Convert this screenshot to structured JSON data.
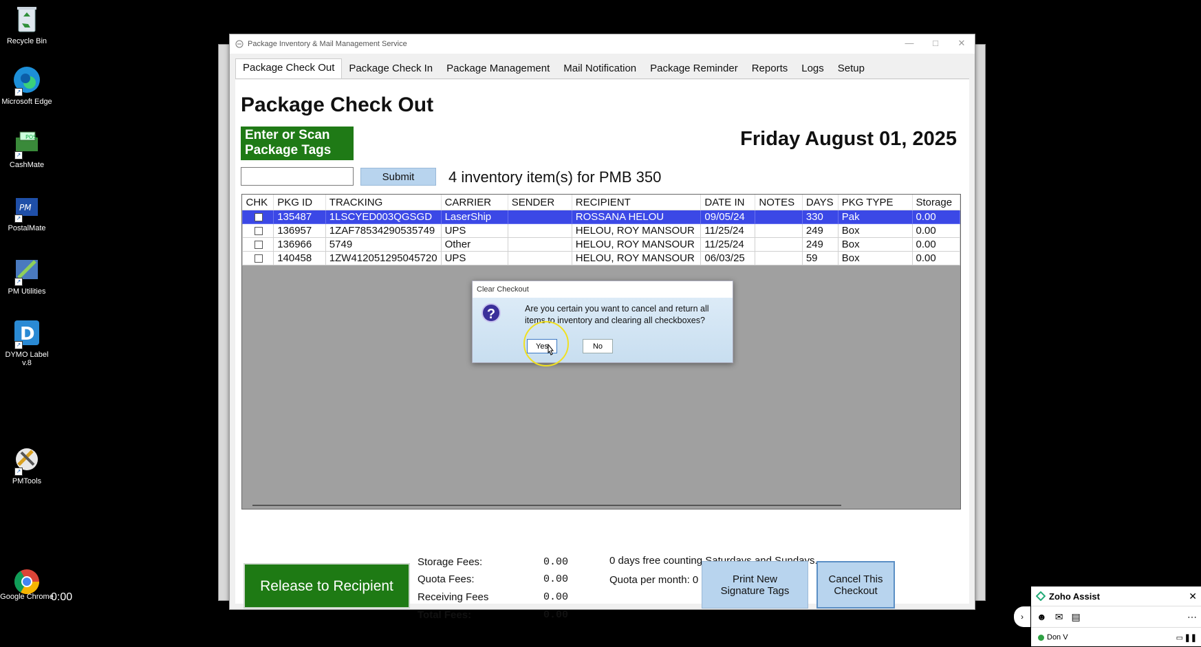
{
  "desktop": {
    "icons": [
      {
        "label": "Recycle Bin",
        "icon": "recycle-bin-icon"
      },
      {
        "label": "Microsoft Edge",
        "icon": "edge-icon"
      },
      {
        "label": "CashMate",
        "icon": "cashmate-icon"
      },
      {
        "label": "PostalMate",
        "icon": "postalmate-icon"
      },
      {
        "label": "PM Utilities",
        "icon": "pm-utilities-icon"
      },
      {
        "label": "DYMO Label v.8",
        "icon": "dymo-icon"
      },
      {
        "label": "PMTools",
        "icon": "pmtools-icon"
      },
      {
        "label": "Google Chrome",
        "icon": "chrome-icon"
      }
    ],
    "timer": "0:00"
  },
  "window": {
    "title": "Package Inventory & Mail Management Service",
    "tabs": [
      "Package Check Out",
      "Package Check In",
      "Package Management",
      "Mail Notification",
      "Package Reminder",
      "Reports",
      "Logs",
      "Setup"
    ]
  },
  "checkout": {
    "page_title": "Package Check Out",
    "scan_label": "Enter or Scan Package Tags",
    "date": "Friday August 01, 2025",
    "tag_input_value": "",
    "submit_label": "Submit",
    "inventory_count": "4 inventory item(s) for PMB 350",
    "table": {
      "columns": [
        "CHK",
        "PKG ID",
        "TRACKING",
        "CARRIER",
        "SENDER",
        "RECIPIENT",
        "DATE IN",
        "NOTES",
        "DAYS",
        "PKG TYPE",
        "Storage"
      ],
      "rows": [
        {
          "pkg_id": "135487",
          "tracking": "1LSCYED003QGSGD",
          "carrier": "LaserShip",
          "sender": "",
          "recipient": "ROSSANA HELOU",
          "date_in": "09/05/24",
          "notes": "",
          "days": "330",
          "pkg_type": "Pak",
          "storage": "0.00",
          "selected": true
        },
        {
          "pkg_id": "136957",
          "tracking": "1ZAF78534290535749",
          "carrier": "UPS",
          "sender": "",
          "recipient": "HELOU, ROY MANSOUR",
          "date_in": "11/25/24",
          "notes": "",
          "days": "249",
          "pkg_type": "Box",
          "storage": "0.00",
          "selected": false
        },
        {
          "pkg_id": "136966",
          "tracking": "5749",
          "carrier": "Other",
          "sender": "",
          "recipient": "HELOU, ROY MANSOUR",
          "date_in": "11/25/24",
          "notes": "",
          "days": "249",
          "pkg_type": "Box",
          "storage": "0.00",
          "selected": false
        },
        {
          "pkg_id": "140458",
          "tracking": "1ZW412051295045720",
          "carrier": "UPS",
          "sender": "",
          "recipient": "HELOU, ROY MANSOUR",
          "date_in": "06/03/25",
          "notes": "",
          "days": "59",
          "pkg_type": "Box",
          "storage": "0.00",
          "selected": false
        }
      ]
    },
    "fees": {
      "storage_label": "Storage Fees:",
      "storage_value": "0.00",
      "quota_label": "Quota Fees:",
      "quota_value": "0.00",
      "receiving_label": "Receiving Fees",
      "receiving_value": "0.00",
      "total_label": "Total Fees:",
      "total_value": "0.00"
    },
    "free_days_note": "0 days free counting Saturdays and Sundays.",
    "quota_note": "Quota per month: 0",
    "release_label": "Release to Recipient",
    "print_label": "Print New Signature Tags",
    "cancel_label": "Cancel This Checkout"
  },
  "dialog": {
    "title": "Clear Checkout",
    "message": "Are you certain you want to cancel and return all items to inventory and clearing all checkboxes?",
    "yes_label": "Yes",
    "no_label": "No",
    "icon": "question-icon"
  },
  "zoho": {
    "title": "Zoho Assist",
    "user": "Don V",
    "status_color": "#2ea043"
  }
}
